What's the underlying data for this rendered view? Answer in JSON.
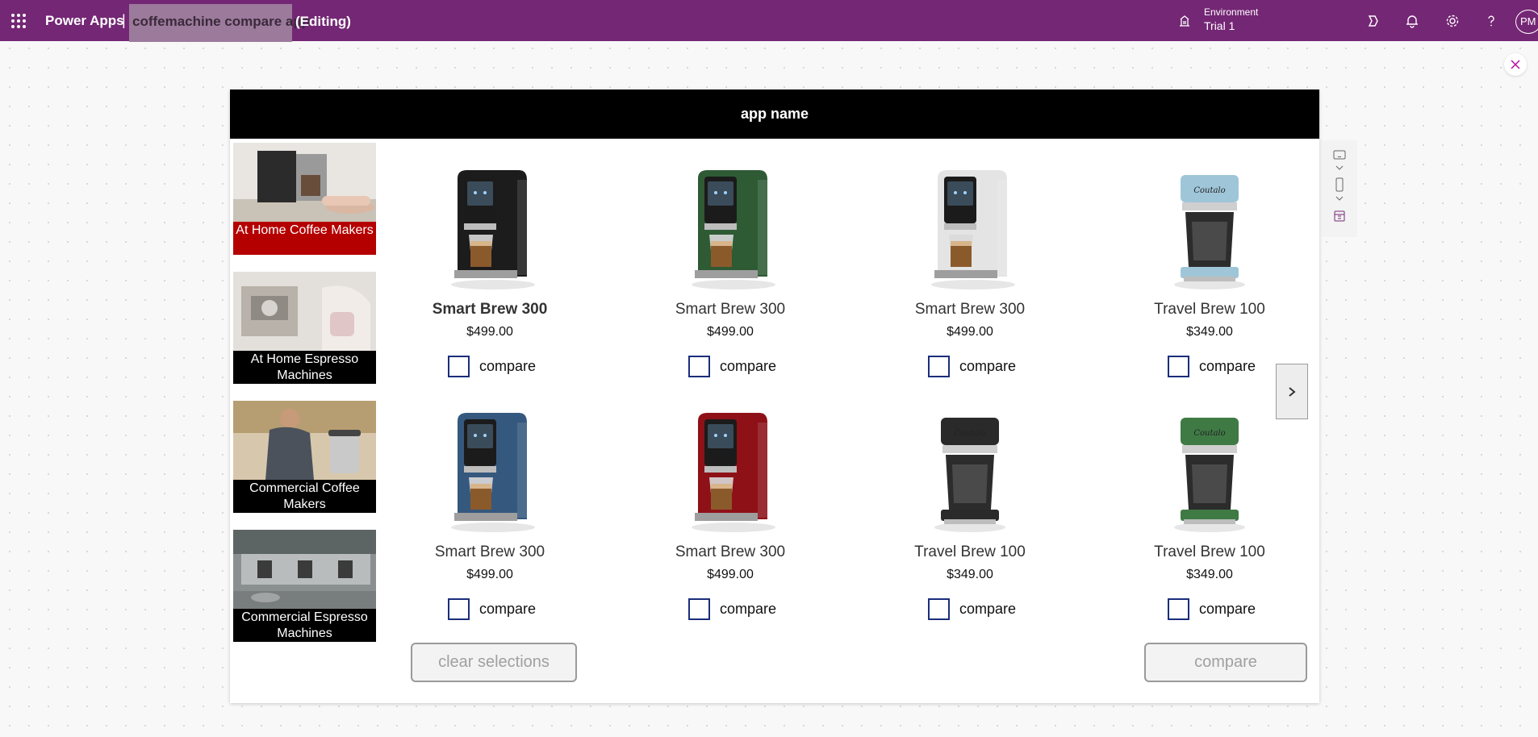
{
  "topbar": {
    "brand": "Power Apps",
    "separator": "|",
    "app_name": "coffemachine compare app",
    "mode": "(Editing)",
    "environment_label": "Environment",
    "environment_value": "Trial 1",
    "avatar_initials": "PM",
    "icons": [
      "waffle-icon",
      "environment-icon",
      "copilot-icon",
      "bell-icon",
      "gear-icon",
      "help-icon"
    ]
  },
  "colors": {
    "topbar": "#742774",
    "header": "#000000",
    "selected_category": "#b50000",
    "checkbox_border": "#1a2e7a"
  },
  "app": {
    "title": "app name",
    "categories": [
      {
        "label": "At Home Coffee Makers",
        "selected": true
      },
      {
        "label": "At Home Espresso Machines",
        "selected": false
      },
      {
        "label": "Commercial Coffee Makers",
        "selected": false
      },
      {
        "label": "Commercial Espresso Machines",
        "selected": false
      }
    ],
    "products": [
      {
        "name": "Smart Brew 300",
        "price": "$499.00",
        "compare": "compare",
        "color": "#1c1c1c",
        "kind": "espresso",
        "checked": false
      },
      {
        "name": "Smart Brew 300",
        "price": "$499.00",
        "compare": "compare",
        "color": "#2e5a34",
        "kind": "espresso",
        "checked": false
      },
      {
        "name": "Smart Brew 300",
        "price": "$499.00",
        "compare": "compare",
        "color": "#e4e4e4",
        "kind": "espresso",
        "checked": false
      },
      {
        "name": "Travel Brew 100",
        "price": "$349.00",
        "compare": "compare",
        "color": "#9fc6d8",
        "kind": "drip",
        "checked": false
      },
      {
        "name": "Smart Brew 300",
        "price": "$499.00",
        "compare": "compare",
        "color": "#35587e",
        "kind": "espresso",
        "checked": false
      },
      {
        "name": "Smart Brew 300",
        "price": "$499.00",
        "compare": "compare",
        "color": "#8e1118",
        "kind": "espresso",
        "checked": false
      },
      {
        "name": "Travel Brew 100",
        "price": "$349.00",
        "compare": "compare",
        "color": "#2a2a2a",
        "kind": "drip",
        "checked": false
      },
      {
        "name": "Travel Brew 100",
        "price": "$349.00",
        "compare": "compare",
        "color": "#3f7a45",
        "kind": "drip",
        "checked": false
      }
    ],
    "clear_button": "clear selections",
    "compare_button": "compare",
    "next_icon": "chevron-right-icon"
  }
}
